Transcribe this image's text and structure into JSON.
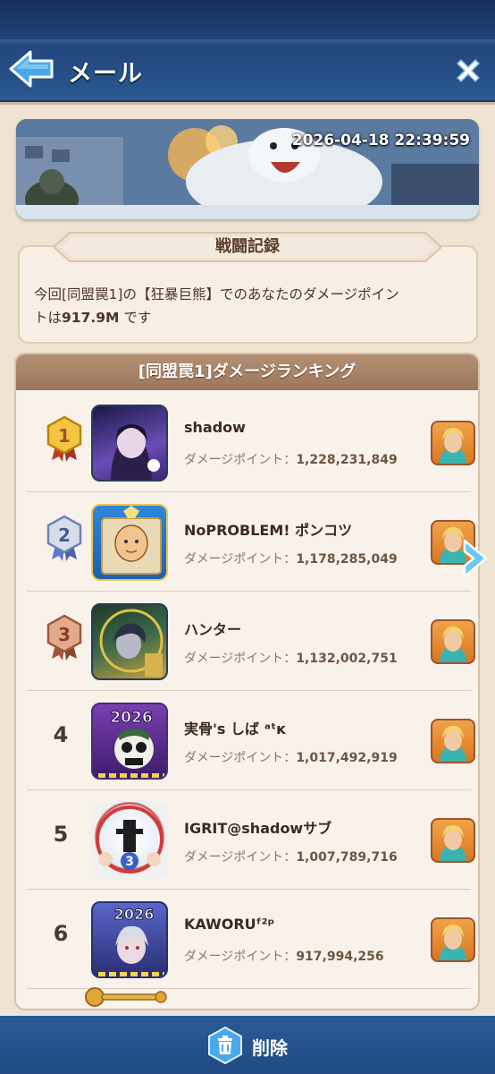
{
  "header": {
    "title": "メール"
  },
  "banner": {
    "timestamp": "2026-04-18 22:39:59"
  },
  "record": {
    "title": "戦闘記録",
    "text_prefix": "今回[同盟罠1]の【狂暴巨熊】でのあなたのダメージポイン",
    "text_line2_prefix": "トは",
    "damage": "917.9M",
    "text_suffix": " です"
  },
  "ranking": {
    "header": "[同盟罠1]ダメージランキング",
    "damage_label": "ダメージポイント：",
    "rows": [
      {
        "rank": "1",
        "name": "shadow",
        "damage": "1,228,231,849"
      },
      {
        "rank": "2",
        "name": "NoPROBLEM! ポンコツ",
        "damage": "1,178,285,049"
      },
      {
        "rank": "3",
        "name": "ハンター",
        "damage": "1,132,002,751"
      },
      {
        "rank": "4",
        "name": "実骨's しば ᵃᵗĸ",
        "damage": "1,017,492,919"
      },
      {
        "rank": "5",
        "name": "IGRIT@shadowサブ",
        "damage": "1,007,789,716"
      },
      {
        "rank": "6",
        "name": "KAWORUᶠ²ᵖ",
        "damage": "917,994,256"
      }
    ]
  },
  "avatars": {
    "avatar4_year": "2026",
    "avatar5_level": "3",
    "avatar6_year": "2026"
  },
  "footer": {
    "delete_label": "削除"
  },
  "colors": {
    "panel_bg": "#efe3d2",
    "header_bar": "#21477c",
    "ranking_header": "#a9826a",
    "accent_blue": "#3a9ee0"
  }
}
